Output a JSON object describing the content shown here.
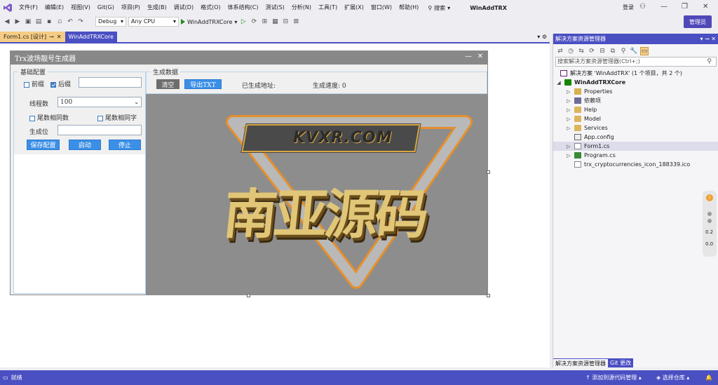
{
  "menu": {
    "items": [
      "文件(F)",
      "编辑(E)",
      "视图(V)",
      "Git(G)",
      "项目(P)",
      "生成(B)",
      "调试(D)",
      "格式(O)",
      "体系结构(C)",
      "测试(S)",
      "分析(N)",
      "工具(T)",
      "扩展(X)",
      "窗口(W)",
      "帮助(H)"
    ],
    "search_label": "搜索",
    "solution_title": "WinAddTRX",
    "login_label": "登录",
    "admin_label": "管理员"
  },
  "toolbar": {
    "config": "Debug",
    "platform": "Any CPU",
    "run_target": "WinAddTRXCore"
  },
  "doc_tabs": [
    {
      "label": "Form1.cs [设计]",
      "active": true
    },
    {
      "label": "WinAddTRXCore",
      "active": false
    }
  ],
  "form": {
    "title": "Trx波场靓号生成器",
    "basic_group": "基础配置",
    "prefix_label": "前缀",
    "suffix_label": "后缀",
    "thread_label": "线程数",
    "thread_value": "100",
    "tail_same_num": "尾数相同数",
    "tail_same_char": "尾数相同字",
    "gen_pos_label": "生成位",
    "save_btn": "保存配置",
    "start_btn": "启动",
    "stop_btn": "停止",
    "data_group": "生成数据",
    "clear_btn": "清空",
    "export_btn": "导出TXT",
    "generated_addr": "已生成地址:",
    "speed_label": "生成速度: 0",
    "watermark_top": "KVXR.COM",
    "watermark_main": "南亚源码"
  },
  "solution_explorer": {
    "header": "解决方案资源管理器",
    "search_placeholder": "搜索解决方案资源管理器(Ctrl+;)",
    "items": [
      {
        "label": "解决方案 'WinAddTRX' (1 个项目，共 2 个)",
        "icon": "solution-icon"
      },
      {
        "label": "WinAddTRXCore",
        "icon": "project-icon"
      },
      {
        "label": "Properties",
        "icon": "properties-icon"
      },
      {
        "label": "依赖项",
        "icon": "dependencies-icon"
      },
      {
        "label": "Help",
        "icon": "folder-icon"
      },
      {
        "label": "Model",
        "icon": "folder-icon"
      },
      {
        "label": "Services",
        "icon": "folder-icon"
      },
      {
        "label": "App.config",
        "icon": "config-icon"
      },
      {
        "label": "Form1.cs",
        "icon": "form-icon"
      },
      {
        "label": "Program.cs",
        "icon": "csharp-icon"
      },
      {
        "label": "trx_cryptocurrencies_icon_188339.ico",
        "icon": "file-icon"
      }
    ],
    "tab_explorer": "解决方案资源管理器",
    "tab_git": "Git 更改"
  },
  "side_notif": {
    "val1": "0.2",
    "val2": "0.0"
  },
  "status": {
    "ready": "就绪",
    "add_source": "添加到源代码管理",
    "select_repo": "选择仓库"
  },
  "colors": {
    "accent": "#4a4fc2",
    "tab_active": "#f5cc84",
    "form_button": "#3b8fe6"
  }
}
